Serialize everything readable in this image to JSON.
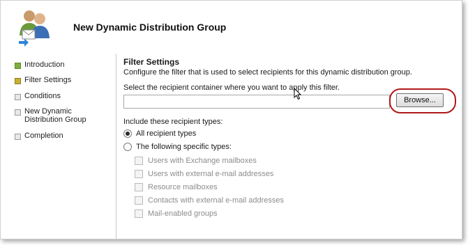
{
  "window": {
    "title": "New Dynamic Distribution Group"
  },
  "nav": {
    "items": [
      {
        "label": "Introduction",
        "state": "done"
      },
      {
        "label": "Filter Settings",
        "state": "current"
      },
      {
        "label": "Conditions",
        "state": "pending"
      },
      {
        "label": "New Dynamic Distribution Group",
        "state": "pending"
      },
      {
        "label": "Completion",
        "state": "pending"
      }
    ]
  },
  "filter": {
    "title": "Filter Settings",
    "description": "Configure the filter that is used to select recipients for this dynamic distribution group.",
    "container_prompt": "Select the recipient container where you want to apply this filter.",
    "container_value": "",
    "browse_label": "Browse...",
    "types_prompt": "Include these recipient types:",
    "radios": [
      {
        "label": "All recipient types",
        "checked": true
      },
      {
        "label": "The following specific types:",
        "checked": false
      }
    ],
    "types": [
      {
        "label": "Users with Exchange mailboxes",
        "checked": false,
        "enabled": false
      },
      {
        "label": "Users with external e-mail addresses",
        "checked": false,
        "enabled": false
      },
      {
        "label": "Resource mailboxes",
        "checked": false,
        "enabled": false
      },
      {
        "label": "Contacts with external e-mail addresses",
        "checked": false,
        "enabled": false
      },
      {
        "label": "Mail-enabled groups",
        "checked": false,
        "enabled": false
      }
    ]
  },
  "colors": {
    "highlight": "#b01818",
    "done": "#7fae3c",
    "current": "#c9b032"
  }
}
